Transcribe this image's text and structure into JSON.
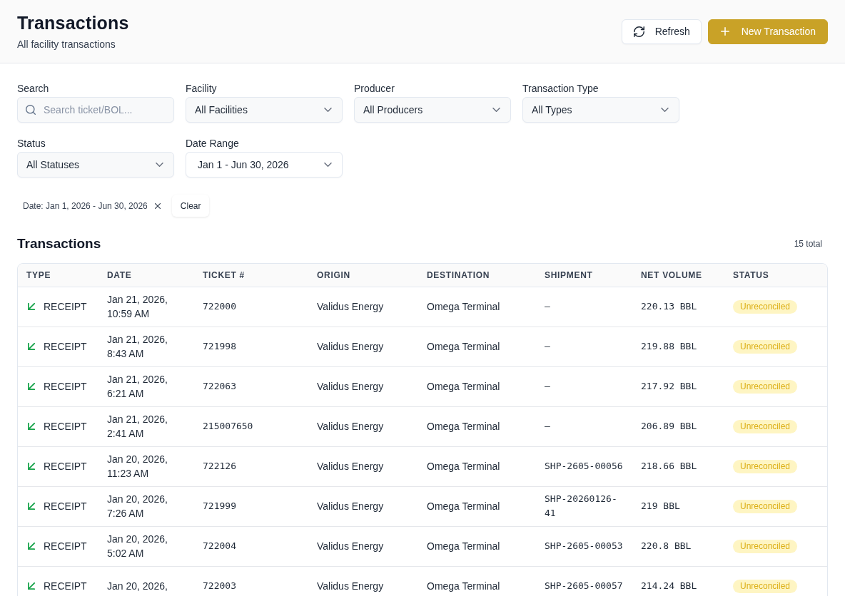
{
  "header": {
    "title": "Transactions",
    "subtitle": "All facility transactions",
    "buttons": [
      {
        "kind": "refresh",
        "label": "Refresh"
      },
      {
        "kind": "add",
        "label": "New Transaction"
      }
    ]
  },
  "filters": {
    "rows": [
      {
        "fields": [
          {
            "kind": "search",
            "label": "Search",
            "placeholder": "Search ticket/BOL..."
          },
          {
            "kind": "select",
            "label": "Facility",
            "value": "All Facilities"
          },
          {
            "kind": "select",
            "label": "Producer",
            "value": "All Producers"
          },
          {
            "kind": "select",
            "label": "Transaction Type",
            "value": "All Types"
          }
        ]
      },
      {
        "fields": [
          {
            "kind": "select",
            "label": "Status",
            "value": "All Statuses"
          },
          {
            "kind": "daterange",
            "label": "Date Range",
            "value": "Jan 1 - Jun 30, 2026"
          }
        ]
      }
    ],
    "active_filters": [
      {
        "label": "Date: Jan 1, 2026 - Jun 30, 2026"
      }
    ],
    "clear_label": "Clear"
  },
  "table": {
    "title": "Transactions",
    "count": "15 total",
    "columns": [
      "TYPE",
      "DATE",
      "TICKET #",
      "ORIGIN",
      "DESTINATION",
      "SHIPMENT",
      "NET VOLUME",
      "STATUS"
    ],
    "rows": [
      {
        "type": "RECEIPT",
        "date": "Jan 21, 2026, 10:59 AM",
        "ticket": "722000",
        "origin": "Validus Energy",
        "destination": "Omega Terminal",
        "shipment": "—",
        "net_volume": "220.13 BBL",
        "status": "Unreconciled"
      },
      {
        "type": "RECEIPT",
        "date": "Jan 21, 2026, 8:43 AM",
        "ticket": "721998",
        "origin": "Validus Energy",
        "destination": "Omega Terminal",
        "shipment": "—",
        "net_volume": "219.88 BBL",
        "status": "Unreconciled"
      },
      {
        "type": "RECEIPT",
        "date": "Jan 21, 2026, 6:21 AM",
        "ticket": "722063",
        "origin": "Validus Energy",
        "destination": "Omega Terminal",
        "shipment": "—",
        "net_volume": "217.92 BBL",
        "status": "Unreconciled"
      },
      {
        "type": "RECEIPT",
        "date": "Jan 21, 2026, 2:41 AM",
        "ticket": "215007650",
        "origin": "Validus Energy",
        "destination": "Omega Terminal",
        "shipment": "—",
        "net_volume": "206.89 BBL",
        "status": "Unreconciled"
      },
      {
        "type": "RECEIPT",
        "date": "Jan 20, 2026, 11:23 AM",
        "ticket": "722126",
        "origin": "Validus Energy",
        "destination": "Omega Terminal",
        "shipment": "SHP-2605-00056",
        "net_volume": "218.66 BBL",
        "status": "Unreconciled"
      },
      {
        "type": "RECEIPT",
        "date": "Jan 20, 2026, 7:26 AM",
        "ticket": "721999",
        "origin": "Validus Energy",
        "destination": "Omega Terminal",
        "shipment": "SHP-20260126-41",
        "net_volume": "219 BBL",
        "status": "Unreconciled"
      },
      {
        "type": "RECEIPT",
        "date": "Jan 20, 2026, 5:02 AM",
        "ticket": "722004",
        "origin": "Validus Energy",
        "destination": "Omega Terminal",
        "shipment": "SHP-2605-00053",
        "net_volume": "220.8 BBL",
        "status": "Unreconciled"
      },
      {
        "type": "RECEIPT",
        "date": "Jan 20, 2026,",
        "ticket": "722003",
        "origin": "Validus Energy",
        "destination": "Omega Terminal",
        "shipment": "SHP-2605-00057",
        "net_volume": "214.24 BBL",
        "status": "Unreconciled"
      }
    ]
  }
}
